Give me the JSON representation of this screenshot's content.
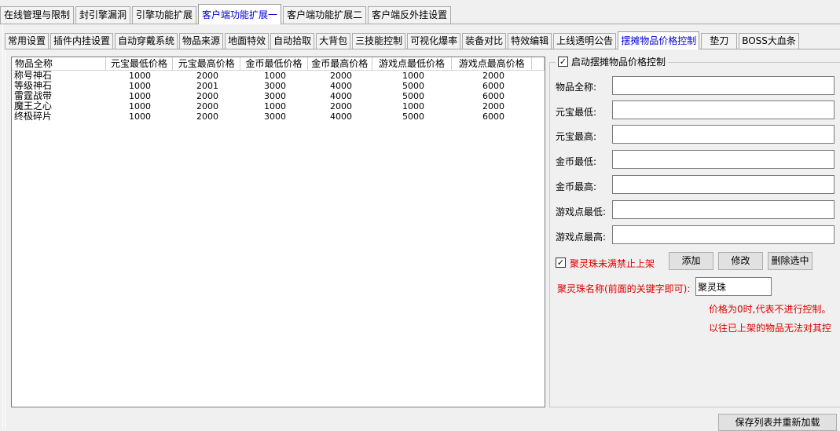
{
  "top_tabs": [
    "在线管理与限制",
    "封引擎漏洞",
    "引擎功能扩展",
    "客户端功能扩展一",
    "客户端功能扩展二",
    "客户端反外挂设置"
  ],
  "sub_tabs": [
    "常用设置",
    "插件内挂设置",
    "自动穿戴系统",
    "物品来源",
    "地面特效",
    "自动拾取",
    "大背包",
    "三技能控制",
    "可视化爆率",
    "装备对比",
    "特效编辑",
    "上线透明公告",
    "摆摊物品价格控制",
    "垫刀",
    "BOSS大血条"
  ],
  "table": {
    "headers": [
      "物品全称",
      "元宝最低价格",
      "元宝最高价格",
      "金币最低价格",
      "金币最高价格",
      "游戏点最低价格",
      "游戏点最高价格"
    ],
    "rows": [
      [
        "称号神石",
        "1000",
        "2000",
        "1000",
        "2000",
        "1000",
        "2000"
      ],
      [
        "等级神石",
        "1000",
        "2001",
        "3000",
        "4000",
        "5000",
        "6000"
      ],
      [
        "雷霆战带",
        "1000",
        "2000",
        "3000",
        "4000",
        "5000",
        "6000"
      ],
      [
        "魔王之心",
        "1000",
        "2000",
        "1000",
        "2000",
        "1000",
        "2000"
      ],
      [
        "终极碎片",
        "1000",
        "2000",
        "3000",
        "4000",
        "5000",
        "6000"
      ]
    ]
  },
  "control": {
    "enable_label": "启动摆摊物品价格控制",
    "enable_checked": "✓",
    "fields": [
      {
        "label": "物品全称:",
        "value": ""
      },
      {
        "label": "元宝最低:",
        "value": ""
      },
      {
        "label": "元宝最高:",
        "value": ""
      },
      {
        "label": "金币最低:",
        "value": ""
      },
      {
        "label": "金币最高:",
        "value": ""
      },
      {
        "label": "游戏点最低:",
        "value": ""
      },
      {
        "label": "游戏点最高:",
        "value": ""
      }
    ],
    "ban_label": "聚灵珠未满禁止上架",
    "ban_checked": "✓",
    "add_label": "添加",
    "modify_label": "修改",
    "delete_label": "删除选中",
    "name_label": "聚灵珠名称(前面的关键字即可):",
    "name_value": "聚灵珠",
    "note1": "价格为0时,代表不进行控制。",
    "note2": "以往已上架的物品无法对其控",
    "save_label": "保存列表并重新加载"
  },
  "colors": {
    "active_tab": "#0000cc",
    "warning": "#dd0000"
  }
}
